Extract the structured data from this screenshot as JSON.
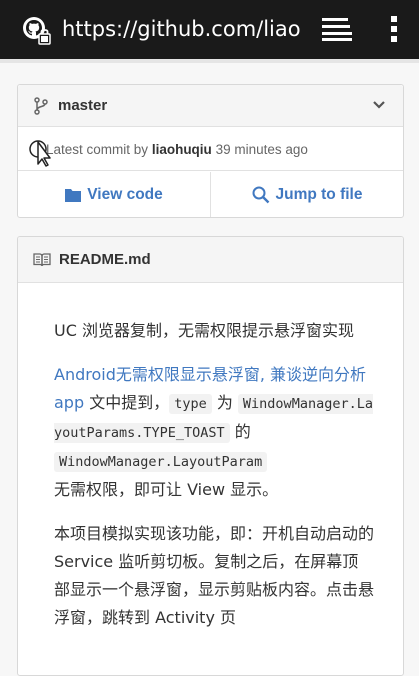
{
  "browser": {
    "url": "https://github.com/liaohuqiu"
  },
  "repo": {
    "branch": "master",
    "commit": {
      "prefix": "Latest commit by",
      "author": "liaohuqiu",
      "time": "39 minutes ago"
    },
    "view_code_label": "View code",
    "jump_to_file_label": "Jump to file"
  },
  "readme": {
    "title": "README.md",
    "p1": "UC 浏览器复制，无需权限提示悬浮窗实现",
    "p2_link": "Android无需权限显示悬浮窗, 兼谈逆向分析app",
    "p2_a": " 文中提到，",
    "p2_code1": "type",
    "p2_b": " 为",
    "p2_code2": "WindowManager.LayoutParams.TYPE_TOAST",
    "p2_c": " 的 ",
    "p2_code3": "WindowManager.LayoutParam",
    "p2_d": "无需权限，即可让 View 显示。",
    "p3": "本项目模拟实现该功能，即：开机自动启动的 Service 监听剪切板。复制之后，在屏幕顶部显示一个悬浮窗，显示剪贴板内容。点击悬浮窗，跳转到 Activity 页"
  },
  "colors": {
    "topbar": "#1a1a1a",
    "link": "#4078c0",
    "border": "#d8d8d8"
  },
  "icons": [
    "github-lock-favicon",
    "tabs-icon",
    "overflow-menu-icon",
    "branch-icon",
    "chevron-down-icon",
    "folder-icon",
    "search-icon",
    "book-icon",
    "mouse-cursor-icon"
  ]
}
